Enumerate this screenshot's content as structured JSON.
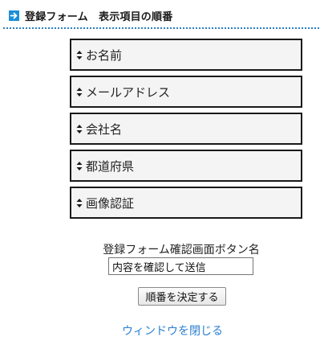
{
  "header": {
    "title": "登録フォーム　表示項目の順番",
    "icon": "arrow-right-icon",
    "accent_color": "#1a8fd6"
  },
  "sort_list": {
    "items": [
      {
        "label": "お名前"
      },
      {
        "label": "メールアドレス"
      },
      {
        "label": "会社名"
      },
      {
        "label": "都道府県"
      },
      {
        "label": "画像認証"
      }
    ],
    "handle_icon": "sort-handle-icon"
  },
  "confirm_button_setting": {
    "label": "登録フォーム確認画面ボタン名",
    "value": "内容を確認して送信"
  },
  "decide_button": {
    "label": "順番を決定する"
  },
  "close_link": {
    "label": "ウィンドウを閉じる",
    "color": "#2a7fd0"
  }
}
